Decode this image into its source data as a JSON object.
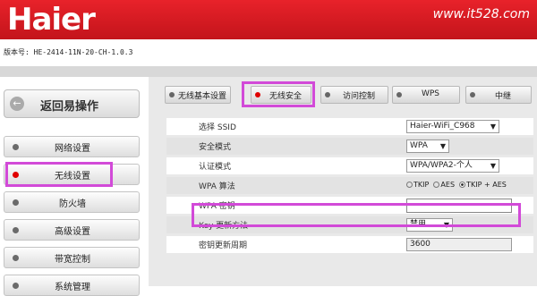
{
  "header": {
    "logo": "Haier",
    "watermark": "www.it528.com"
  },
  "version": "版本号: HE-2414-11N-20-CH-1.0.3",
  "sidebar": {
    "back_label": "返回易操作",
    "items": [
      {
        "label": "网络设置",
        "active": false
      },
      {
        "label": "无线设置",
        "active": true
      },
      {
        "label": "防火墙",
        "active": false
      },
      {
        "label": "高级设置",
        "active": false
      },
      {
        "label": "带宽控制",
        "active": false
      },
      {
        "label": "系统管理",
        "active": false
      }
    ]
  },
  "tabs": [
    {
      "label": "无线基本设置",
      "active": false
    },
    {
      "label": "无线安全",
      "active": true
    },
    {
      "label": "访问控制",
      "active": false
    },
    {
      "label": "WPS",
      "active": false
    },
    {
      "label": "中继",
      "active": false
    }
  ],
  "form": {
    "ssid": {
      "label": "选择 SSID",
      "value": "Haier-WiFi_C968"
    },
    "security_mode": {
      "label": "安全模式",
      "value": "WPA"
    },
    "auth_mode": {
      "label": "认证模式",
      "value": "WPA/WPA2-个人"
    },
    "wpa_algo": {
      "label": "WPA 算法",
      "options": [
        "TKIP",
        "AES",
        "TKIP + AES"
      ],
      "selected": "TKIP + AES"
    },
    "wpa_key": {
      "label": "WPA 密钥",
      "value": ""
    },
    "key_update": {
      "label": "Key 更新方法",
      "value": "禁用"
    },
    "key_period": {
      "label": "密钥更新周期",
      "value": "3600"
    }
  },
  "colors": {
    "brand_red": "#d21a21",
    "highlight": "#d24ad8",
    "active_dot": "#e00000"
  }
}
